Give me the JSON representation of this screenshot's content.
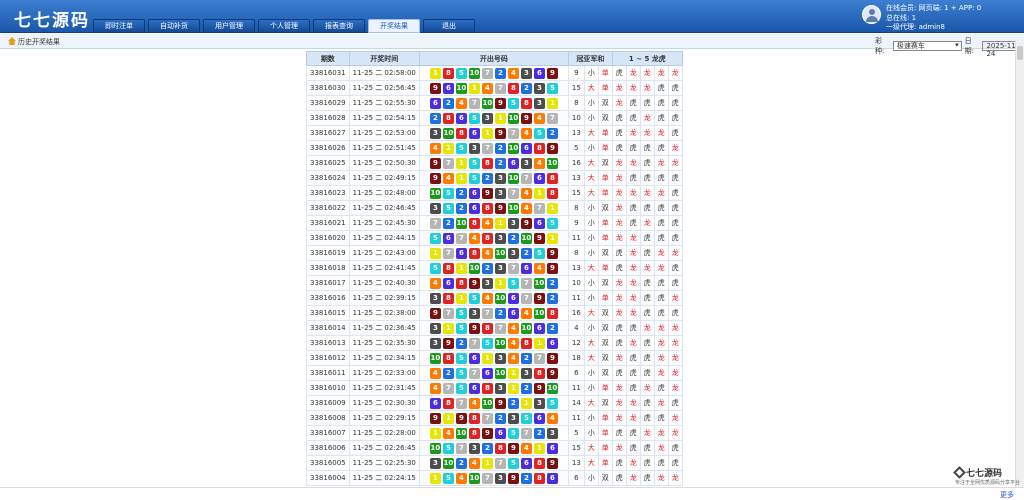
{
  "app": {
    "logo": "七七源码"
  },
  "nav": {
    "tabs": [
      "即时注单",
      "自动补货",
      "用户管理",
      "个人管理",
      "报表查询",
      "开奖结果",
      "退出"
    ],
    "active": 5
  },
  "user": {
    "online_members": "在线会员:  网页端: 1 + APP: 0",
    "total_online": "总在线: 1",
    "agent": "一级代理: admin8"
  },
  "breadcrumb": {
    "label": "历史开奖结果"
  },
  "filters": {
    "game_label": "彩种:",
    "game_value": "极速赛车",
    "date_label": "日期:",
    "date_value": "2025-11-24"
  },
  "table": {
    "headers": [
      "期数",
      "开奖时间",
      "开出号码",
      "冠亚军和",
      "1 ~ 5 龙虎"
    ],
    "rows": [
      {
        "issue": "33816031",
        "time": "11-25 二 02:58:00",
        "balls": [
          1,
          8,
          5,
          10,
          7,
          2,
          4,
          3,
          6,
          9
        ],
        "sum": "9",
        "size": "小",
        "parity": "单",
        "lh": [
          "虎",
          "龙",
          "龙",
          "龙",
          "龙"
        ]
      },
      {
        "issue": "33816030",
        "time": "11-25 二 02:56:45",
        "balls": [
          9,
          6,
          10,
          1,
          4,
          7,
          8,
          2,
          3,
          5
        ],
        "sum": "15",
        "size": "大",
        "parity": "单",
        "lh": [
          "龙",
          "龙",
          "龙",
          "虎",
          "虎"
        ]
      },
      {
        "issue": "33816029",
        "time": "11-25 二 02:55:30",
        "balls": [
          6,
          2,
          4,
          7,
          10,
          9,
          5,
          8,
          3,
          1
        ],
        "sum": "8",
        "size": "小",
        "parity": "双",
        "lh": [
          "龙",
          "虎",
          "虎",
          "虎",
          "虎"
        ]
      },
      {
        "issue": "33816028",
        "time": "11-25 二 02:54:15",
        "balls": [
          2,
          8,
          6,
          5,
          3,
          1,
          10,
          9,
          4,
          7
        ],
        "sum": "10",
        "size": "小",
        "parity": "双",
        "lh": [
          "虎",
          "虎",
          "龙",
          "虎",
          "虎"
        ]
      },
      {
        "issue": "33816027",
        "time": "11-25 二 02:53:00",
        "balls": [
          3,
          10,
          8,
          6,
          1,
          9,
          7,
          4,
          5,
          2
        ],
        "sum": "13",
        "size": "大",
        "parity": "单",
        "lh": [
          "虎",
          "龙",
          "龙",
          "龙",
          "虎"
        ]
      },
      {
        "issue": "33816026",
        "time": "11-25 二 02:51:45",
        "balls": [
          4,
          1,
          5,
          3,
          7,
          2,
          10,
          6,
          8,
          9
        ],
        "sum": "5",
        "size": "小",
        "parity": "单",
        "lh": [
          "虎",
          "虎",
          "虎",
          "虎",
          "龙"
        ]
      },
      {
        "issue": "33816025",
        "time": "11-25 二 02:50:30",
        "balls": [
          9,
          7,
          1,
          5,
          8,
          2,
          6,
          3,
          4,
          10
        ],
        "sum": "16",
        "size": "大",
        "parity": "双",
        "lh": [
          "龙",
          "龙",
          "虎",
          "龙",
          "龙"
        ]
      },
      {
        "issue": "33816024",
        "time": "11-25 二 02:49:15",
        "balls": [
          9,
          4,
          1,
          5,
          2,
          3,
          10,
          7,
          6,
          8
        ],
        "sum": "13",
        "size": "大",
        "parity": "单",
        "lh": [
          "龙",
          "虎",
          "虎",
          "虎",
          "虎"
        ]
      },
      {
        "issue": "33816023",
        "time": "11-25 二 02:48:00",
        "balls": [
          10,
          5,
          2,
          6,
          9,
          3,
          7,
          4,
          1,
          8
        ],
        "sum": "15",
        "size": "大",
        "parity": "单",
        "lh": [
          "龙",
          "龙",
          "龙",
          "龙",
          "虎"
        ]
      },
      {
        "issue": "33816022",
        "time": "11-25 二 02:46:45",
        "balls": [
          3,
          5,
          2,
          6,
          8,
          9,
          10,
          4,
          7,
          1
        ],
        "sum": "8",
        "size": "小",
        "parity": "双",
        "lh": [
          "龙",
          "虎",
          "虎",
          "虎",
          "虎"
        ]
      },
      {
        "issue": "33816021",
        "time": "11-25 二 02:45:30",
        "balls": [
          7,
          2,
          10,
          8,
          4,
          1,
          3,
          9,
          6,
          5
        ],
        "sum": "9",
        "size": "小",
        "parity": "单",
        "lh": [
          "龙",
          "虎",
          "龙",
          "虎",
          "虎"
        ]
      },
      {
        "issue": "33816020",
        "time": "11-25 二 02:44:15",
        "balls": [
          5,
          6,
          7,
          4,
          8,
          3,
          2,
          10,
          9,
          1
        ],
        "sum": "11",
        "size": "小",
        "parity": "单",
        "lh": [
          "龙",
          "龙",
          "虎",
          "虎",
          "虎"
        ]
      },
      {
        "issue": "33816019",
        "time": "11-25 二 02:43:00",
        "balls": [
          1,
          7,
          6,
          8,
          4,
          10,
          3,
          2,
          5,
          9
        ],
        "sum": "8",
        "size": "小",
        "parity": "双",
        "lh": [
          "虎",
          "龙",
          "虎",
          "龙",
          "龙"
        ]
      },
      {
        "issue": "33816018",
        "time": "11-25 二 02:41:45",
        "balls": [
          5,
          8,
          1,
          10,
          2,
          3,
          7,
          6,
          4,
          9
        ],
        "sum": "13",
        "size": "大",
        "parity": "单",
        "lh": [
          "虎",
          "龙",
          "龙",
          "龙",
          "虎"
        ]
      },
      {
        "issue": "33816017",
        "time": "11-25 二 02:40:30",
        "balls": [
          4,
          6,
          8,
          9,
          3,
          1,
          5,
          7,
          10,
          2
        ],
        "sum": "10",
        "size": "小",
        "parity": "双",
        "lh": [
          "龙",
          "龙",
          "虎",
          "虎",
          "虎"
        ]
      },
      {
        "issue": "33816016",
        "time": "11-25 二 02:39:15",
        "balls": [
          3,
          8,
          1,
          5,
          4,
          10,
          6,
          7,
          9,
          2
        ],
        "sum": "11",
        "size": "小",
        "parity": "单",
        "lh": [
          "龙",
          "龙",
          "虎",
          "虎",
          "龙"
        ]
      },
      {
        "issue": "33816015",
        "time": "11-25 二 02:38:00",
        "balls": [
          9,
          7,
          5,
          3,
          7,
          2,
          6,
          4,
          10,
          8
        ],
        "sum": "16",
        "size": "大",
        "parity": "双",
        "lh": [
          "龙",
          "龙",
          "虎",
          "虎",
          "虎"
        ]
      },
      {
        "issue": "33816014",
        "time": "11-25 二 02:36:45",
        "balls": [
          3,
          1,
          5,
          9,
          8,
          7,
          4,
          10,
          6,
          2
        ],
        "sum": "4",
        "size": "小",
        "parity": "双",
        "lh": [
          "虎",
          "虎",
          "龙",
          "龙",
          "龙"
        ]
      },
      {
        "issue": "33816013",
        "time": "11-25 二 02:35:30",
        "balls": [
          3,
          9,
          2,
          7,
          5,
          10,
          4,
          8,
          1,
          6
        ],
        "sum": "12",
        "size": "大",
        "parity": "双",
        "lh": [
          "虎",
          "龙",
          "虎",
          "龙",
          "龙"
        ]
      },
      {
        "issue": "33816012",
        "time": "11-25 二 02:34:15",
        "balls": [
          10,
          8,
          5,
          6,
          1,
          3,
          4,
          2,
          7,
          9
        ],
        "sum": "18",
        "size": "大",
        "parity": "双",
        "lh": [
          "龙",
          "虎",
          "虎",
          "龙",
          "龙"
        ]
      },
      {
        "issue": "33816011",
        "time": "11-25 二 02:33:00",
        "balls": [
          4,
          2,
          5,
          7,
          6,
          10,
          1,
          3,
          8,
          9
        ],
        "sum": "6",
        "size": "小",
        "parity": "双",
        "lh": [
          "虎",
          "虎",
          "虎",
          "龙",
          "龙"
        ]
      },
      {
        "issue": "33816010",
        "time": "11-25 二 02:31:45",
        "balls": [
          4,
          7,
          5,
          6,
          8,
          3,
          1,
          2,
          9,
          10
        ],
        "sum": "11",
        "size": "小",
        "parity": "单",
        "lh": [
          "龙",
          "虎",
          "龙",
          "虎",
          "龙"
        ]
      },
      {
        "issue": "33816009",
        "time": "11-25 二 02:30:30",
        "balls": [
          6,
          8,
          7,
          4,
          10,
          9,
          2,
          1,
          3,
          5
        ],
        "sum": "14",
        "size": "大",
        "parity": "双",
        "lh": [
          "龙",
          "龙",
          "虎",
          "龙",
          "虎"
        ]
      },
      {
        "issue": "33816008",
        "time": "11-25 二 02:29:15",
        "balls": [
          9,
          1,
          9,
          8,
          7,
          2,
          3,
          5,
          6,
          4
        ],
        "sum": "11",
        "size": "小",
        "parity": "单",
        "lh": [
          "龙",
          "龙",
          "虎",
          "虎",
          "龙"
        ]
      },
      {
        "issue": "33816007",
        "time": "11-25 二 02:28:00",
        "balls": [
          1,
          4,
          10,
          8,
          9,
          6,
          5,
          7,
          2,
          3
        ],
        "sum": "5",
        "size": "小",
        "parity": "单",
        "lh": [
          "虎",
          "虎",
          "龙",
          "龙",
          "龙"
        ]
      },
      {
        "issue": "33816006",
        "time": "11-25 二 02:26:45",
        "balls": [
          10,
          5,
          7,
          3,
          2,
          8,
          9,
          4,
          1,
          6
        ],
        "sum": "15",
        "size": "大",
        "parity": "单",
        "lh": [
          "龙",
          "虎",
          "虎",
          "龙",
          "虎"
        ]
      },
      {
        "issue": "33816005",
        "time": "11-25 二 02:25:30",
        "balls": [
          3,
          10,
          2,
          4,
          1,
          7,
          5,
          6,
          8,
          9
        ],
        "sum": "13",
        "size": "大",
        "parity": "单",
        "lh": [
          "虎",
          "龙",
          "虎",
          "虎",
          "虎"
        ]
      },
      {
        "issue": "33816004",
        "time": "11-25 二 02:24:15",
        "balls": [
          1,
          5,
          4,
          10,
          7,
          3,
          9,
          2,
          8,
          6
        ],
        "sum": "6",
        "size": "小",
        "parity": "双",
        "lh": [
          "虎",
          "龙",
          "虎",
          "龙",
          "龙"
        ]
      }
    ]
  },
  "ball_colors": {
    "1": "#e6e600",
    "2": "#1f6fe0",
    "3": "#4d4d4d",
    "4": "#ff7a00",
    "5": "#20d0d8",
    "6": "#4b2cde",
    "7": "#b5b5b5",
    "8": "#e02222",
    "9": "#7a1010",
    "10": "#1c9a1c"
  },
  "footer": {
    "more": "更多"
  },
  "watermark": {
    "name": "七七源码",
    "tagline": "专注于全网优质源码分享平台"
  }
}
